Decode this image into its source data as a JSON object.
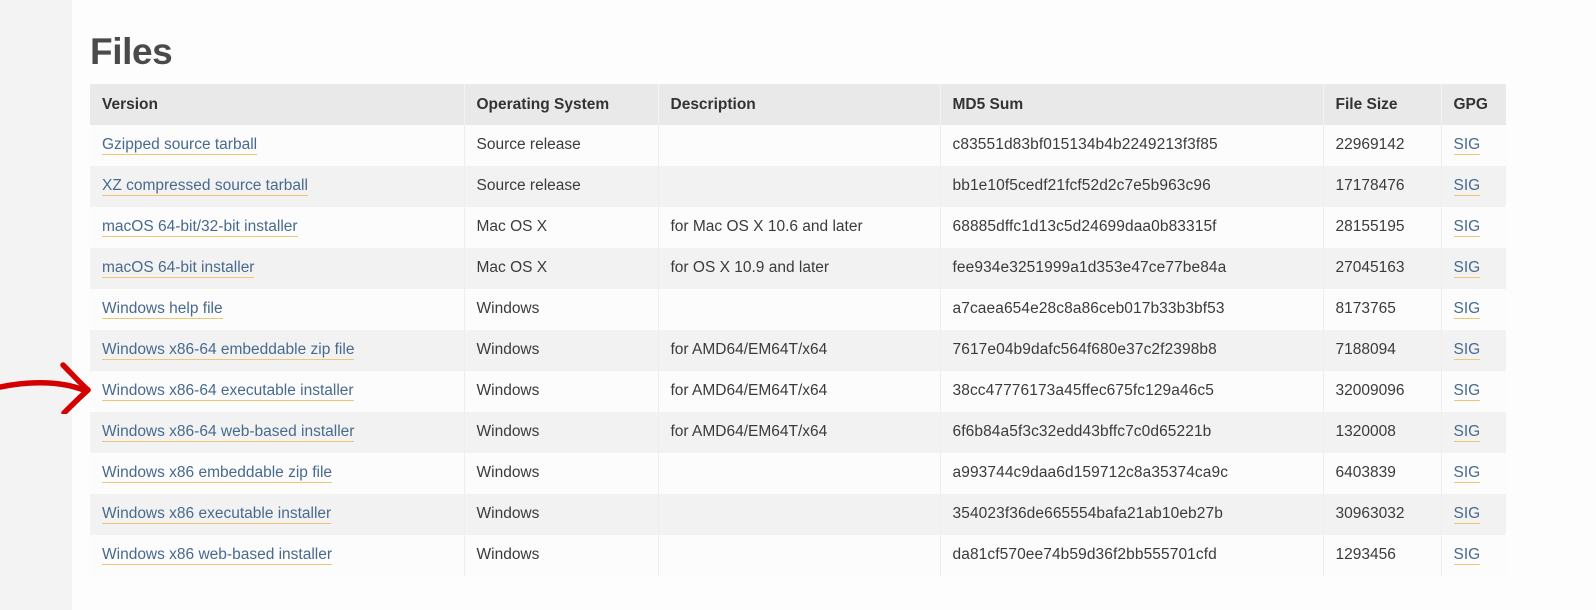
{
  "page": {
    "title": "Files",
    "background_color": "#f3f3f3",
    "card_color": "#fdfdfd"
  },
  "annotation": {
    "type": "hand-drawn-arrow",
    "color": "#d40000",
    "points_to": "Windows x86-64 executable installer",
    "target_row_index": 6
  },
  "table": {
    "headers": [
      "Version",
      "Operating System",
      "Description",
      "MD5 Sum",
      "File Size",
      "GPG"
    ],
    "header_bg": "#e9e9e9",
    "link_color": "#486a8d",
    "link_underline_color": "#f0c674",
    "rows": [
      {
        "version": "Gzipped source tarball",
        "os": "Source release",
        "description": "",
        "md5": "c83551d83bf015134b4b2249213f3f85",
        "size": "22969142",
        "gpg": "SIG"
      },
      {
        "version": "XZ compressed source tarball",
        "os": "Source release",
        "description": "",
        "md5": "bb1e10f5cedf21fcf52d2c7e5b963c96",
        "size": "17178476",
        "gpg": "SIG"
      },
      {
        "version": "macOS 64-bit/32-bit installer",
        "os": "Mac OS X",
        "description": "for Mac OS X 10.6 and later",
        "md5": "68885dffc1d13c5d24699daa0b83315f",
        "size": "28155195",
        "gpg": "SIG"
      },
      {
        "version": "macOS 64-bit installer",
        "os": "Mac OS X",
        "description": "for OS X 10.9 and later",
        "md5": "fee934e3251999a1d353e47ce77be84a",
        "size": "27045163",
        "gpg": "SIG"
      },
      {
        "version": "Windows help file",
        "os": "Windows",
        "description": "",
        "md5": "a7caea654e28c8a86ceb017b33b3bf53",
        "size": "8173765",
        "gpg": "SIG"
      },
      {
        "version": "Windows x86-64 embeddable zip file",
        "os": "Windows",
        "description": "for AMD64/EM64T/x64",
        "md5": "7617e04b9dafc564f680e37c2f2398b8",
        "size": "7188094",
        "gpg": "SIG"
      },
      {
        "version": "Windows x86-64 executable installer",
        "os": "Windows",
        "description": "for AMD64/EM64T/x64",
        "md5": "38cc47776173a45ffec675fc129a46c5",
        "size": "32009096",
        "gpg": "SIG"
      },
      {
        "version": "Windows x86-64 web-based installer",
        "os": "Windows",
        "description": "for AMD64/EM64T/x64",
        "md5": "6f6b84a5f3c32edd43bffc7c0d65221b",
        "size": "1320008",
        "gpg": "SIG"
      },
      {
        "version": "Windows x86 embeddable zip file",
        "os": "Windows",
        "description": "",
        "md5": "a993744c9daa6d159712c8a35374ca9c",
        "size": "6403839",
        "gpg": "SIG"
      },
      {
        "version": "Windows x86 executable installer",
        "os": "Windows",
        "description": "",
        "md5": "354023f36de665554bafa21ab10eb27b",
        "size": "30963032",
        "gpg": "SIG"
      },
      {
        "version": "Windows x86 web-based installer",
        "os": "Windows",
        "description": "",
        "md5": "da81cf570ee74b59d36f2bb555701cfd",
        "size": "1293456",
        "gpg": "SIG"
      }
    ]
  }
}
